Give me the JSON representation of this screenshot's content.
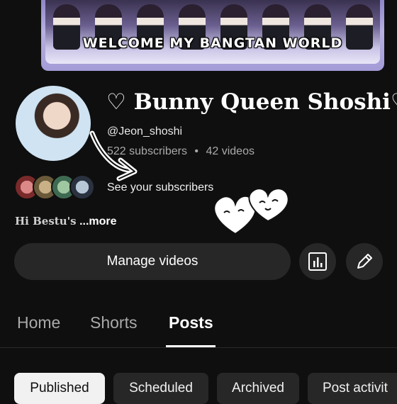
{
  "banner": {
    "text": "WELCOME MY BANGTAN WORLD"
  },
  "channel": {
    "name": "♡ Bunny Queen Shoshi♡",
    "handle": "@Jeon_shoshi",
    "subscribers": "522 subscribers",
    "separator": "•",
    "videos": "42 videos",
    "see_subscribers": "See your subscribers",
    "bio": "Hi Bestu's",
    "bio_more": "...more"
  },
  "actions": {
    "manage_videos": "Manage videos"
  },
  "tabs": [
    {
      "label": "Home",
      "active": false
    },
    {
      "label": "Shorts",
      "active": false
    },
    {
      "label": "Posts",
      "active": true
    }
  ],
  "filters": [
    {
      "label": "Published",
      "active": true
    },
    {
      "label": "Scheduled",
      "active": false
    },
    {
      "label": "Archived",
      "active": false
    },
    {
      "label": "Post activit",
      "active": false
    }
  ],
  "colors": {
    "background": "#0f0f0f",
    "button": "#272727",
    "text_secondary": "#aaaaaa",
    "banner_accent": "#a39bd6"
  }
}
